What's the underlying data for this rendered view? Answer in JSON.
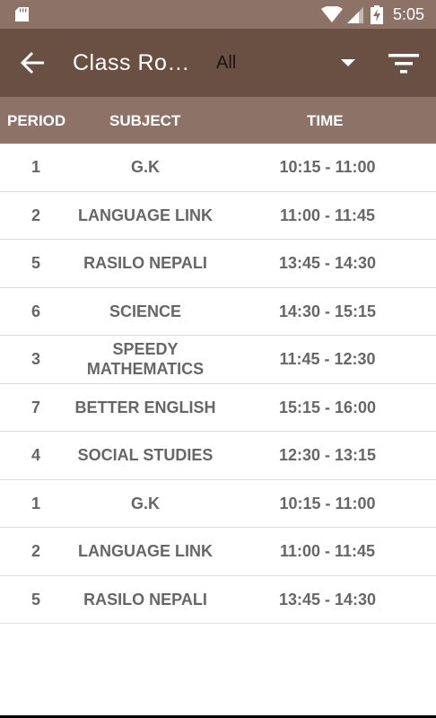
{
  "status_bar": {
    "time": "5:05"
  },
  "toolbar": {
    "title": "Class Ro…",
    "filter_value": "All"
  },
  "table": {
    "headers": {
      "period": "PERIOD",
      "subject": "SUBJECT",
      "time": "TIME"
    },
    "rows": [
      {
        "period": "1",
        "subject": "G.K",
        "time": "10:15 - 11:00"
      },
      {
        "period": "2",
        "subject": "LANGUAGE LINK",
        "time": "11:00 - 11:45"
      },
      {
        "period": "5",
        "subject": "RASILO NEPALI",
        "time": "13:45 - 14:30"
      },
      {
        "period": "6",
        "subject": "SCIENCE",
        "time": "14:30 - 15:15"
      },
      {
        "period": "3",
        "subject": "SPEEDY MATHEMATICS",
        "time": "11:45 - 12:30"
      },
      {
        "period": "7",
        "subject": "BETTER ENGLISH",
        "time": "15:15 - 16:00"
      },
      {
        "period": "4",
        "subject": "SOCIAL STUDIES",
        "time": "12:30 - 13:15"
      },
      {
        "period": "1",
        "subject": "G.K",
        "time": "10:15 - 11:00"
      },
      {
        "period": "2",
        "subject": "LANGUAGE LINK",
        "time": "11:00 - 11:45"
      },
      {
        "period": "5",
        "subject": "RASILO NEPALI",
        "time": "13:45 - 14:30"
      }
    ]
  },
  "colors": {
    "status_bar": "#8d7267",
    "toolbar": "#6a4f43",
    "header": "#8d7267",
    "cell_text": "#666666"
  }
}
